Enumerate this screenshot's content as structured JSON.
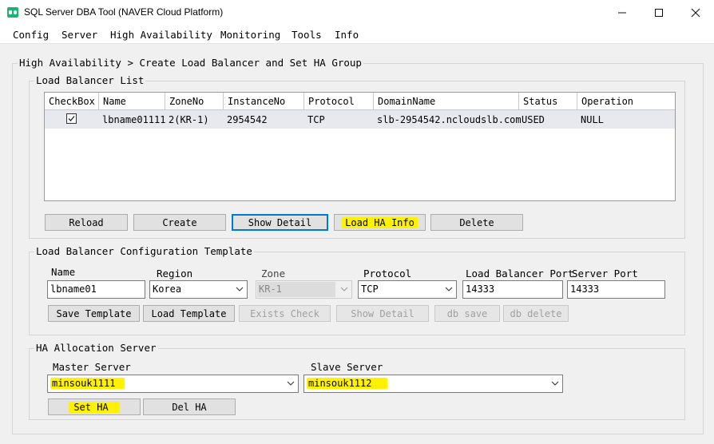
{
  "window": {
    "title": "SQL Server DBA Tool (NAVER Cloud Platform)",
    "minimize_icon": "minimize-icon",
    "maximize_icon": "maximize-icon",
    "close_icon": "close-icon"
  },
  "menu": [
    "Config",
    "Server",
    "High Availability",
    "Monitoring",
    "Tools",
    "Info"
  ],
  "page_title": "High Availability > Create Load Balancer and Set HA Group",
  "lb_list": {
    "title": "Load Balancer List",
    "columns": [
      "CheckBox",
      "Name",
      "ZoneNo",
      "InstanceNo",
      "Protocol",
      "DomainName",
      "Status",
      "Operation"
    ],
    "rows": [
      {
        "checked": true,
        "name": "lbname01111",
        "zone": "2(KR-1)",
        "instance": "2954542",
        "protocol": "TCP",
        "domain": "slb-2954542.ncloudslb.com",
        "status": "USED",
        "operation": "NULL"
      }
    ],
    "buttons": {
      "reload": "Reload",
      "create": "Create",
      "show_detail": "Show Detail",
      "load_ha_info": "Load HA Info",
      "delete": "Delete"
    }
  },
  "template": {
    "title": "Load Balancer Configuration Template",
    "labels": {
      "name": "Name",
      "region": "Region",
      "zone": "Zone",
      "protocol": "Protocol",
      "lb_port": "Load Balancer Port",
      "server_port": "Server Port"
    },
    "values": {
      "name": "lbname01",
      "region": "Korea",
      "zone": "KR-1",
      "protocol": "TCP",
      "lb_port": "14333",
      "server_port": "14333"
    },
    "buttons": {
      "save_template": "Save Template",
      "load_template": "Load Template",
      "exists_check": "Exists Check",
      "show_detail": "Show Detail",
      "db_save": "db save",
      "db_delete": "db delete"
    }
  },
  "ha": {
    "title": "HA Allocation Server",
    "master_label": "Master Server",
    "master_value": "minsouk1111",
    "slave_label": "Slave Server",
    "slave_value": "minsouk1112",
    "buttons": {
      "set_ha": "Set HA",
      "del_ha": "Del HA"
    }
  },
  "colors": {
    "highlight": "#fff200",
    "selected_row": "#e8e8ef",
    "focus_border": "#0078d7",
    "app_icon": "#1ab574"
  }
}
